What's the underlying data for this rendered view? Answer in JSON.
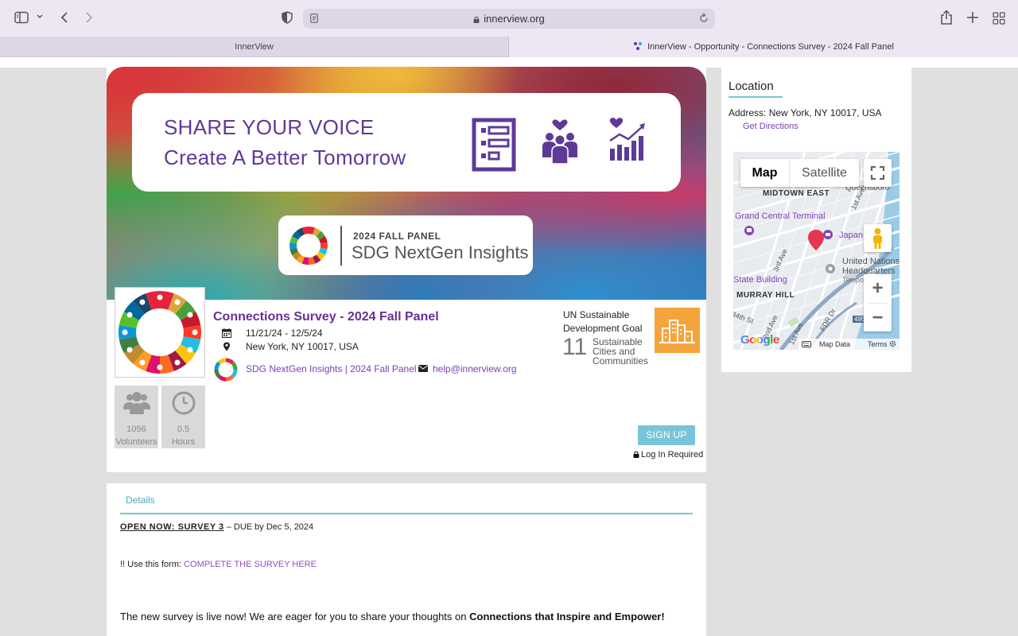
{
  "browser": {
    "url": "innerview.org",
    "tabs": [
      {
        "label": "InnerView"
      },
      {
        "label": "InnerView - Opportunity - Connections Survey - 2024 Fall Panel"
      }
    ]
  },
  "banner": {
    "line1": "SHARE YOUR VOICE",
    "line2": "Create A Better Tomorrow",
    "panel_year": "2024 FALL PANEL",
    "panel_name": "SDG NextGen Insights"
  },
  "opportunity": {
    "title": "Connections Survey - 2024 Fall Panel",
    "dates": "11/21/24 - 12/5/24",
    "location": "New York, NY 10017, USA",
    "organization": "SDG NextGen Insights | 2024 Fall Panel",
    "email": "help@innerview.org",
    "sdg_label": "UN Sustainable Development Goal",
    "sdg_number": "11",
    "sdg_name": "Sustainable Cities and Communities",
    "stats": [
      {
        "value": "1056",
        "label": "Volunteers"
      },
      {
        "value": "0.5",
        "label": "Hours"
      }
    ],
    "signup_label": "SIGN UP",
    "login_required": "Log In Required"
  },
  "location": {
    "title": "Location",
    "address": "Address: New York, NY 10017, USA",
    "directions": "Get Directions",
    "map": {
      "type_map": "Map",
      "type_satellite": "Satellite",
      "labels": {
        "midtown_east": "MIDTOWN EAST",
        "queensboro": "Queensboro",
        "grand_central": "Grand Central Terminal",
        "first_ave": "1st Ave",
        "japan": "Japan",
        "un_hq_1": "United Nations",
        "un_hq_2": "Headquarters",
        "temp": "Tempo",
        "third_ave": "3rd Ave",
        "empire": "State Building",
        "murray": "MURRAY HILL",
        "thirty_fourth": "34th St",
        "fdr": "FDR Dr",
        "route": "495",
        "second_ave": "2nd Ave",
        "first_ave_b": "1st Ave"
      },
      "map_data": "Map Data",
      "terms": "Terms",
      "google": "Google"
    }
  },
  "details": {
    "tab": "Details",
    "open_now": "OPEN NOW: SURVEY 3",
    "due": " – DUE by Dec 5, 2024",
    "form_prefix": "!! Use this form: ",
    "form_link": "COMPLETE THE SURVEY HERE",
    "live_text": "The new survey is live now! We are eager for you to share your thoughts on ",
    "live_bold": "Connections that Inspire and Empower!"
  },
  "colors": {
    "purple_title": "#6a2e9c",
    "link_purple": "#7a3fb5",
    "teal_accent": "#79c4d8",
    "sdg11_orange": "#f5a43c"
  }
}
